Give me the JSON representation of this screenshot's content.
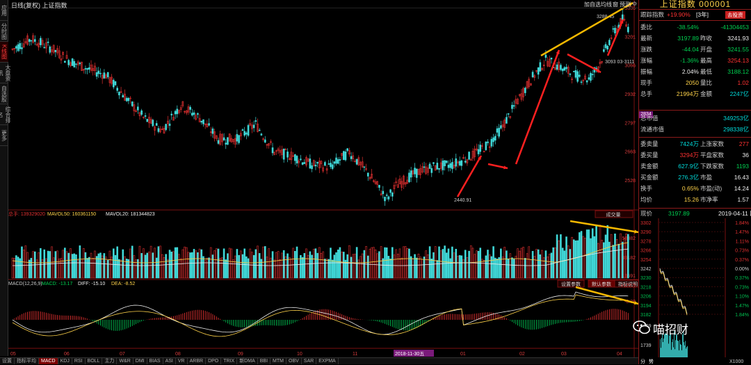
{
  "left_tabs": [
    {
      "label": "应用",
      "active": false
    },
    {
      "label": "分时图",
      "active": false
    },
    {
      "label": "K线图",
      "active": true
    },
    {
      "label": "大盘资讯",
      "active": false
    },
    {
      "label": "自选股",
      "active": false
    },
    {
      "label": "综合排名",
      "active": false
    },
    {
      "label": "更多",
      "active": false
    }
  ],
  "top_bar": {
    "title": "日线(复权) 上证指数",
    "buttons": [
      "加自选",
      "均线",
      "窗",
      "预测"
    ]
  },
  "price_axis": [
    "3336",
    "3201",
    "3066",
    "2932",
    "2797",
    "2663",
    "2528"
  ],
  "current_price_tag": "2834",
  "annotations": {
    "low": "2440.91",
    "high": "3288.45",
    "marker": "3093  03-3111"
  },
  "volume_header": {
    "total": "总手: 139329020",
    "mavol50": "MAVOL50: 160361150",
    "mavol20": "MAVOL20: 181344823",
    "button": "成交量"
  },
  "volume_axis": [
    "58382",
    "39182",
    "19591"
  ],
  "macd_header": {
    "name": "MACD(12,26,9)",
    "macd": "MACD: -13.17",
    "diff": "DIFF: -15.10",
    "dea": "DEA: -8.52",
    "buttons": [
      "设置参数",
      "默认参数",
      "指标说明"
    ]
  },
  "macd_axis": [
    "+122.5",
    "-8.38"
  ],
  "month_labels": [
    "05",
    "06",
    "07",
    "08",
    "09",
    "10",
    "11",
    "2018-11-30五",
    "01",
    "02",
    "03",
    "04"
  ],
  "bottom_tabs": [
    "设置",
    "指标平均",
    "MACD",
    "KDJ",
    "RSI",
    "BOLL",
    "主力",
    "W&R",
    "DMI",
    "BIAS",
    "ASI",
    "VR",
    "ARBR",
    "DPO",
    "TRIX",
    "新DMA",
    "BBI",
    "MTM",
    "OBV",
    "SAR",
    "EXPMA"
  ],
  "bottom_active": "MACD",
  "right_panel": {
    "title": "上证指数 000001",
    "track_label": "跟踪指数",
    "track_value": "+19.90%",
    "track_period": "[3年]",
    "track_button": "去投资",
    "rows": [
      {
        "l1": "委比",
        "v1": "-38.54%",
        "l2": "",
        "v2": "-41304453",
        "c1": "green",
        "c2": "green"
      },
      {
        "l1": "最新",
        "v1": "3197.89",
        "l2": "昨收",
        "v2": "3241.93",
        "c1": "green",
        "c2": "white"
      },
      {
        "l1": "涨跌",
        "v1": "-44.04",
        "l2": "开盘",
        "v2": "3241.55",
        "c1": "green",
        "c2": "green"
      },
      {
        "l1": "涨幅",
        "v1": "-1.36%",
        "l2": "最高",
        "v2": "3254.13",
        "c1": "green",
        "c2": "red"
      },
      {
        "l1": "振幅",
        "v1": "2.04%",
        "l2": "最低",
        "v2": "3188.12",
        "c1": "white",
        "c2": "green"
      },
      {
        "l1": "现手",
        "v1": "2050",
        "l2": "量比",
        "v2": "1.02",
        "c1": "yel",
        "c2": "red"
      },
      {
        "l1": "总手",
        "v1": "21994万",
        "l2": "金额",
        "v2": "2247亿",
        "c1": "yel",
        "c2": "cyan"
      }
    ],
    "rows2": [
      {
        "l1": "总市值",
        "v1": "349253亿",
        "c1": "cyan"
      },
      {
        "l1": "流通市值",
        "v1": "298338亿",
        "c1": "cyan"
      }
    ],
    "rows3": [
      {
        "l1": "委卖量",
        "v1": "7424万",
        "l2": "上涨家数",
        "v2": "277",
        "c1": "cyan",
        "c2": "red"
      },
      {
        "l1": "委买量",
        "v1": "3294万",
        "l2": "平盘家数",
        "v2": "36",
        "c1": "red",
        "c2": "white"
      },
      {
        "l1": "卖金额",
        "v1": "627.9亿",
        "l2": "下跌家数",
        "v2": "1193",
        "c1": "cyan",
        "c2": "green"
      },
      {
        "l1": "买金额",
        "v1": "276.3亿",
        "l2": "市盈",
        "v2": "16.43",
        "c1": "cyan",
        "c2": "white"
      },
      {
        "l1": "换手",
        "v1": "0.65%",
        "l2": "市盈(动)",
        "v2": "14.24",
        "c1": "yel",
        "c2": "white"
      },
      {
        "l1": "均价",
        "v1": "15.26",
        "l2": "市净率",
        "v2": "1.57",
        "c1": "yel",
        "c2": "white"
      }
    ],
    "mini_header": {
      "label": "现价",
      "price": "3197.89",
      "date": "2019-04-11 四"
    },
    "mini_left_axis": [
      "3302",
      "3290",
      "3278",
      "3266",
      "3254",
      "3242",
      "3230",
      "3218",
      "3206",
      "3194",
      "3182"
    ],
    "mini_right_axis": [
      "1.84%",
      "1.47%",
      "1.11%",
      "0.73%",
      "0.37%",
      "0.00%",
      "0.37%",
      "0.73%",
      "1.10%",
      "1.47%",
      "1.84%"
    ],
    "mini_vol_axis": [
      "5169",
      "1739"
    ],
    "mini_bottom": [
      "分",
      "势",
      "X1000"
    ]
  },
  "watermark": "喵招财"
}
